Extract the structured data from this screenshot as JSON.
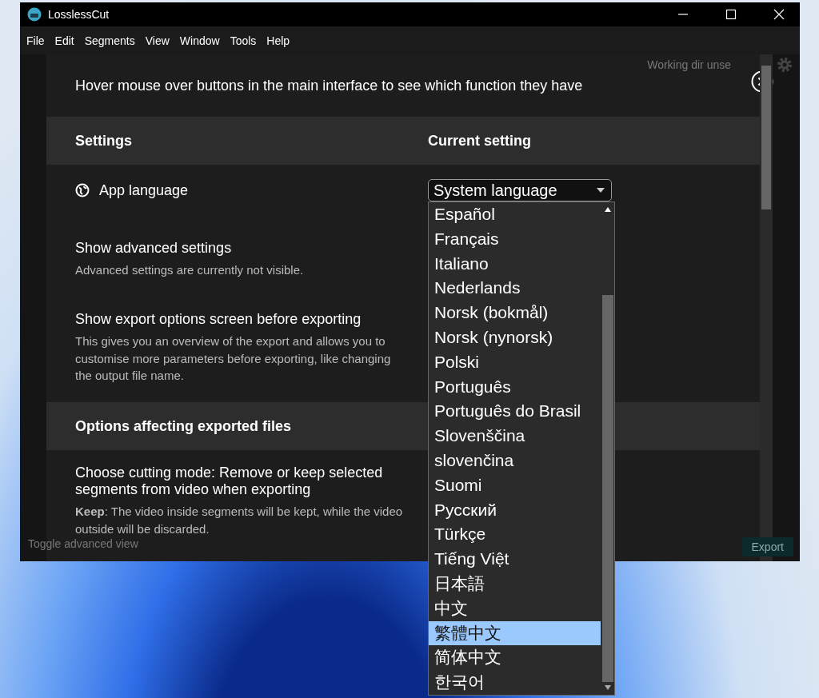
{
  "window": {
    "title": "LosslessCut"
  },
  "menu": [
    "File",
    "Edit",
    "Segments",
    "View",
    "Window",
    "Tools",
    "Help"
  ],
  "hint": "Hover mouse over buttons in the main interface to see which function they have",
  "behind": {
    "working_dir": "Working dir unse",
    "toggle": "Toggle advanced view",
    "export": "Export"
  },
  "rows": [
    {
      "kind": "header",
      "label": "Settings",
      "column_2": "Current setting"
    },
    {
      "kind": "language",
      "label": "App language",
      "select": {
        "value": "System language",
        "expanded": true,
        "options": [
          {
            "label": "Español",
            "selected": false
          },
          {
            "label": "Français",
            "selected": false
          },
          {
            "label": "Italiano",
            "selected": false
          },
          {
            "label": "Nederlands",
            "selected": false
          },
          {
            "label": "Norsk (bokmål)",
            "selected": false
          },
          {
            "label": "Norsk (nynorsk)",
            "selected": false
          },
          {
            "label": "Polski",
            "selected": false
          },
          {
            "label": "Português",
            "selected": false
          },
          {
            "label": "Português do Brasil",
            "selected": false
          },
          {
            "label": "Slovenščina",
            "selected": false
          },
          {
            "label": "slovenčina",
            "selected": false
          },
          {
            "label": "Suomi",
            "selected": false
          },
          {
            "label": "Русский",
            "selected": false
          },
          {
            "label": "Türkçe",
            "selected": false
          },
          {
            "label": "Tiếng Việt",
            "selected": false
          },
          {
            "label": "日本語",
            "selected": false
          },
          {
            "label": "中文",
            "selected": false
          },
          {
            "label": "繁體中文",
            "selected": true
          },
          {
            "label": "简体中文",
            "selected": false
          },
          {
            "label": "한국어",
            "selected": false
          }
        ]
      }
    },
    {
      "kind": "setting",
      "label": "Show advanced settings",
      "description": "Advanced settings are currently not visible."
    },
    {
      "kind": "setting",
      "label": "Show export options screen before exporting",
      "description": "This gives you an overview of the export and allows you to customise more parameters before exporting, like changing the output file name."
    },
    {
      "kind": "section",
      "label": "Options affecting exported files"
    },
    {
      "kind": "setting",
      "label": "Choose cutting mode: Remove or keep selected segments from video when exporting",
      "description": "**Keep**: The video inside segments will be kept, while the video outside will be discarded."
    }
  ]
}
